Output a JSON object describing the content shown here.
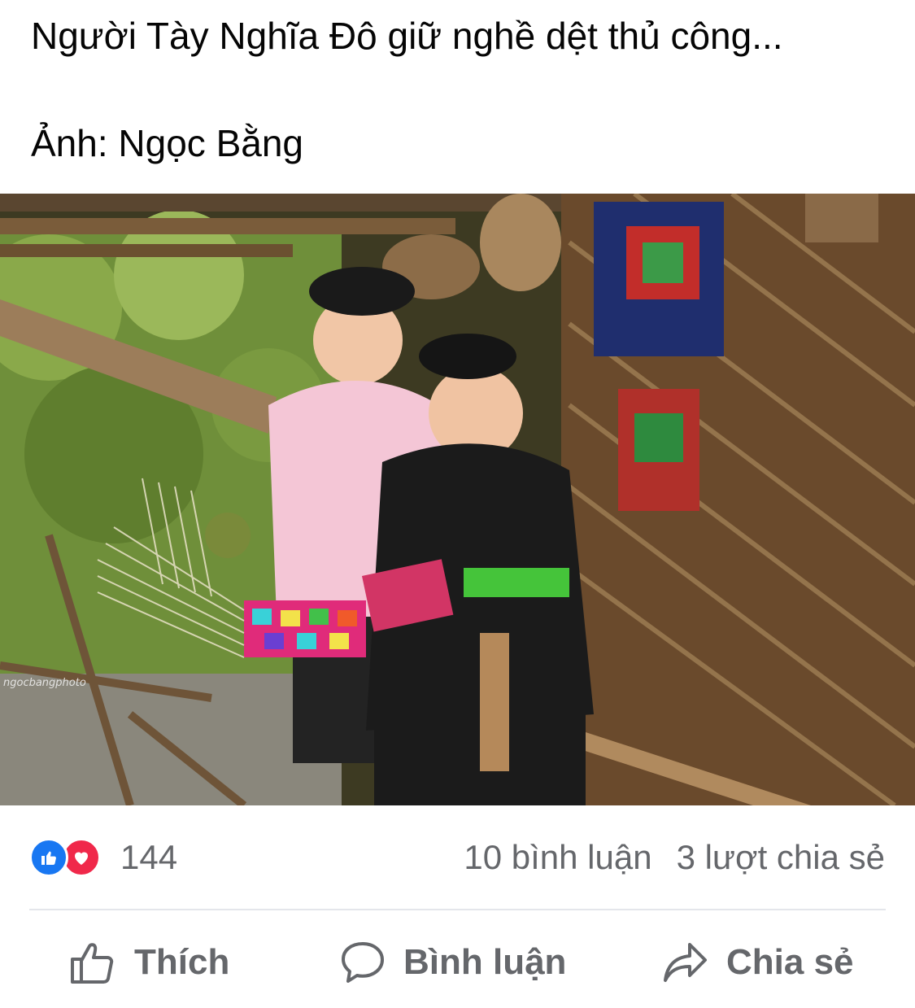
{
  "post": {
    "caption": "Người Tày Nghĩa Đô giữ nghề dệt thủ công...",
    "credit": "Ảnh: Ngọc Bằng",
    "photo_watermark": "ngocbangphoto"
  },
  "reactions": {
    "icons": [
      "like-icon",
      "love-icon"
    ],
    "count": "144",
    "comments": "10 bình luận",
    "shares": "3 lượt chia sẻ"
  },
  "actions": {
    "like_label": "Thích",
    "comment_label": "Bình luận",
    "share_label": "Chia sẻ"
  },
  "colors": {
    "like_blue": "#1877f2",
    "love_red": "#f0284a",
    "secondary_text": "#65676b"
  }
}
